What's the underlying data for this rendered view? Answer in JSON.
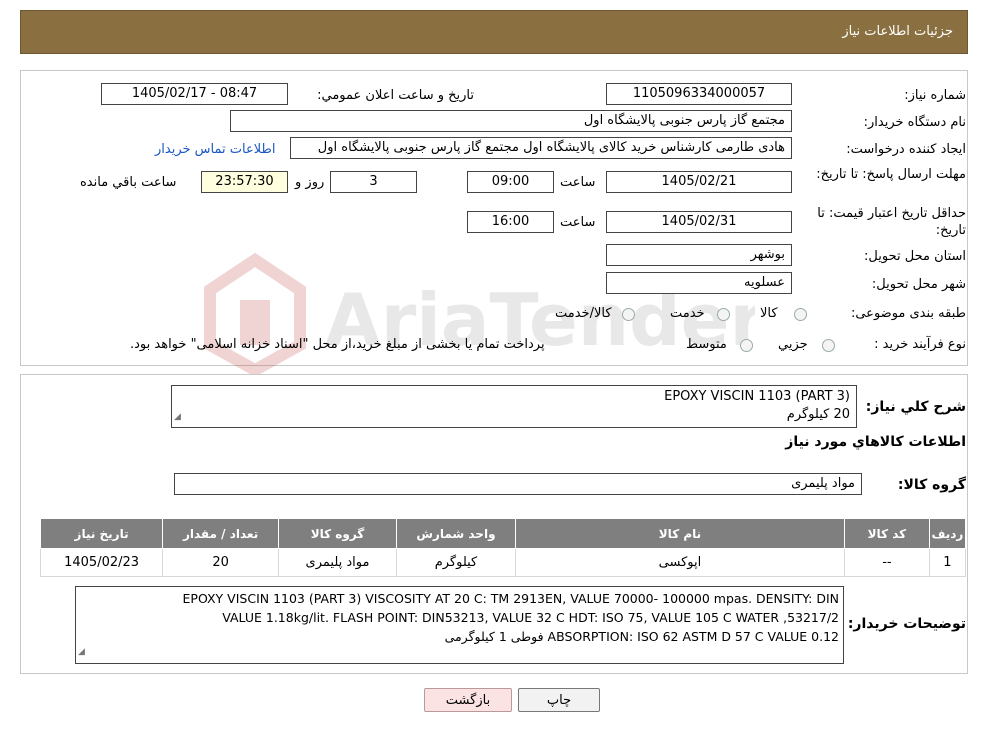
{
  "header": {
    "title": "جزئیات اطلاعات نیاز"
  },
  "labels": {
    "need_number": "شماره نياز:",
    "announce_datetime": "تاريخ و ساعت اعلان عمومي:",
    "buyer_org": "نام دستگاه خريدار:",
    "requester": "ايجاد کننده درخواست:",
    "contact_link": "اطلاعات تماس خريدار",
    "reply_deadline": "مهلت ارسال پاسخ: تا تاريخ:",
    "time": "ساعت",
    "days_and": "روز و",
    "remaining": "ساعت باقي مانده",
    "price_validity": "حداقل تاريخ اعتبار قيمت: تا تاريخ:",
    "province": "استان محل تحويل:",
    "city": "شهر محل تحويل:",
    "category": "طبقه بندی موضوعی:",
    "process_type": "نوع فرآيند خريد :",
    "general_desc": "شرح کلي نياز:",
    "items_info": "اطلاعات کالاهاي مورد نياز",
    "goods_group": "گروه کالا:",
    "buyer_notes": "توضيحات خريدار:"
  },
  "values": {
    "need_number": "1105096334000057",
    "announce_datetime": "1405/02/17 - 08:47",
    "buyer_org": "مجتمع گاز پارس جنوبی  پالایشگاه اول",
    "requester": "هادی طارمی کارشناس خرید کالای پالایشگاه اول مجتمع گاز پارس جنوبی  پالایشگاه اول",
    "reply_date": "1405/02/21",
    "reply_time": "09:00",
    "reply_days": "3",
    "reply_remaining": "23:57:30",
    "validity_date": "1405/02/31",
    "validity_time": "16:00",
    "province": "بوشهر",
    "city": "عسلویه",
    "general_desc_line1": "EPOXY VISCIN 1103 (PART 3)",
    "general_desc_line2": "20 کیلوگرم",
    "goods_group": "مواد پلیمری",
    "buyer_notes_line1": "EPOXY VISCIN 1103 (PART 3) VISCOSITY AT 20 C: TM 2913EN, VALUE 70000- 100000 mpas. DENSITY: DIN",
    "buyer_notes_line2": "53217/2, VALUE 1.18kg/lit. FLASH POINT: DIN53213, VALUE 32 C  HDT: ISO 75, VALUE 105 C  WATER",
    "buyer_notes_line3": "ABSORPTION: ISO 62 ASTM D 57 C VALUE 0.12   فوطی 1 کیلوگرمی"
  },
  "category_options": [
    "کالا",
    "خدمت",
    "کالا/خدمت"
  ],
  "process_options": [
    "جزيي",
    "متوسط"
  ],
  "process_note": "پرداخت تمام يا بخشی از مبلغ خريد،از محل \"اسناد خزانه اسلامی\" خواهد بود.",
  "table": {
    "headers": [
      "رديف",
      "کد کالا",
      "نام کالا",
      "واحد شمارش",
      "گروه کالا",
      "تعداد / مقدار",
      "تاريخ نياز"
    ],
    "rows": [
      [
        "1",
        "--",
        "اپوکسی",
        "کیلوگرم",
        "مواد پلیمری",
        "20",
        "1405/02/23"
      ]
    ]
  },
  "buttons": {
    "print": "چاپ",
    "back": "بازگشت"
  },
  "watermark": {
    "brand": "AriaTender.neT"
  },
  "colors": {
    "header_bg": "#8a7040",
    "table_header_bg": "#7f7f7f",
    "link": "#1a57c4",
    "yellow_field": "#ffffdf"
  }
}
